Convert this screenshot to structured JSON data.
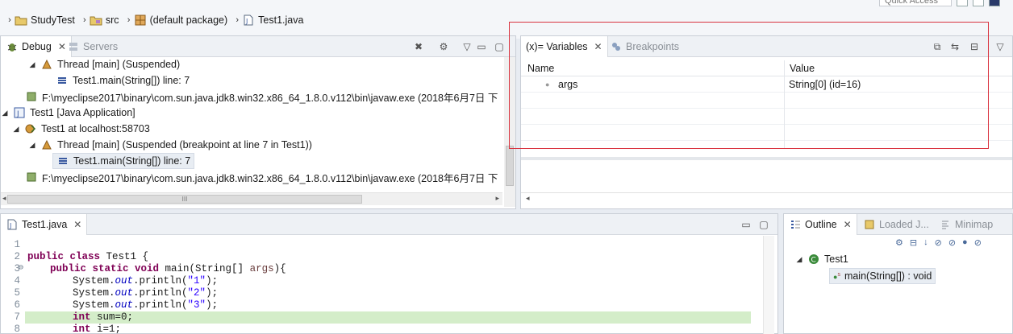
{
  "breadcrumb": {
    "items": [
      "StudyTest",
      "src",
      "(default package)",
      "Test1.java"
    ],
    "quick_access": "Quick Access"
  },
  "debug_view": {
    "tabs": [
      {
        "label": "Debug",
        "active": true
      },
      {
        "label": "Servers",
        "active": false
      }
    ],
    "tree": [
      {
        "label": "Thread [main] (Suspended)"
      },
      {
        "label": "Test1.main(String[]) line: 7"
      },
      {
        "label": "F:\\myeclipse2017\\binary\\com.sun.java.jdk8.win32.x86_64_1.8.0.v112\\bin\\javaw.exe (2018年6月7日 下"
      },
      {
        "label": "Test1 [Java Application]"
      },
      {
        "label": "Test1 at localhost:58703"
      },
      {
        "label": "Thread [main] (Suspended (breakpoint at line 7 in Test1))"
      },
      {
        "label": "Test1.main(String[]) line: 7"
      },
      {
        "label": "F:\\myeclipse2017\\binary\\com.sun.java.jdk8.win32.x86_64_1.8.0.v112\\bin\\javaw.exe (2018年6月7日 下"
      }
    ],
    "hscroll_grip": "III"
  },
  "variables_view": {
    "tabs": [
      {
        "label": "(x)= Variables",
        "active": true
      },
      {
        "label": "Breakpoints",
        "active": false
      }
    ],
    "columns": [
      "Name",
      "Value"
    ],
    "rows": [
      {
        "name": "args",
        "value": "String[0]  (id=16)"
      }
    ]
  },
  "editor": {
    "tab_label": "Test1.java",
    "line_numbers": [
      "1",
      "2",
      "3",
      "4",
      "5",
      "6",
      "7",
      "8"
    ],
    "lines": [
      {
        "kw": "",
        "text": ""
      },
      {
        "kw": "public class",
        "text": " Test1 {"
      },
      {
        "kw": "public static void",
        "text": " main(String[] ",
        "param": "args",
        "tail": "){"
      },
      {
        "pre": "System.",
        "field": "out",
        "post": ".println(",
        "str": "\"1\"",
        "end": ");"
      },
      {
        "pre": "System.",
        "field": "out",
        "post": ".println(",
        "str": "\"2\"",
        "end": ");"
      },
      {
        "pre": "System.",
        "field": "out",
        "post": ".println(",
        "str": "\"3\"",
        "end": ");"
      },
      {
        "kw": "int",
        "text": " sum=0;"
      },
      {
        "kw": "int",
        "text": " i=1;"
      }
    ],
    "fold_marker": "⊖"
  },
  "outline_view": {
    "tabs": [
      {
        "label": "Outline",
        "active": true
      },
      {
        "label": "Loaded J...",
        "active": false
      },
      {
        "label": "Minimap",
        "active": false
      }
    ],
    "class_name": "Test1",
    "method": "main(String[]) : void"
  },
  "colors": {
    "highlight_line": "#d4edc9",
    "red_annotation": "#d9333f",
    "keyword": "#7f0055",
    "string": "#2a00ff"
  }
}
